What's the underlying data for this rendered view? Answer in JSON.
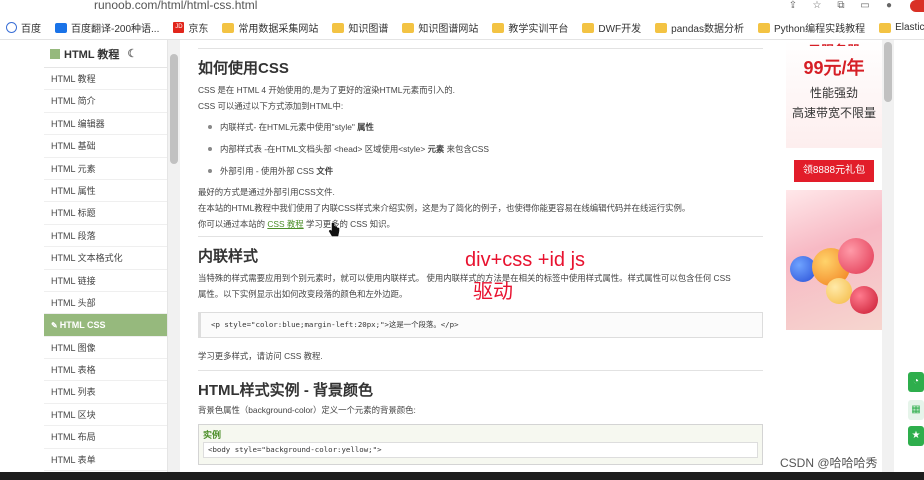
{
  "browser": {
    "url": "runoob.com/html/html-css.html",
    "bookmarks": [
      {
        "label": "百度",
        "icon": "baidu-icon"
      },
      {
        "label": "百度翻译-200种语...",
        "icon": "translate-icon"
      },
      {
        "label": "京东",
        "icon": "jd-icon"
      },
      {
        "label": "常用数据采集网站",
        "icon": "folder-icon"
      },
      {
        "label": "知识图谱",
        "icon": "folder-icon"
      },
      {
        "label": "知识图谱网站",
        "icon": "folder-icon"
      },
      {
        "label": "教学实训平台",
        "icon": "folder-icon"
      },
      {
        "label": "DWF开发",
        "icon": "folder-icon"
      },
      {
        "label": "pandas数据分析",
        "icon": "folder-icon"
      },
      {
        "label": "Python编程实践教程",
        "icon": "folder-icon"
      },
      {
        "label": "Elasticsearch",
        "icon": "folder-icon"
      }
    ],
    "jd_badge": "JD"
  },
  "sidebar": {
    "title": "HTML 教程",
    "moon_icon": "☾",
    "active_tag": "✎",
    "items": [
      {
        "label": "HTML 教程"
      },
      {
        "label": "HTML 简介"
      },
      {
        "label": "HTML 编辑器"
      },
      {
        "label": "HTML 基础"
      },
      {
        "label": "HTML 元素"
      },
      {
        "label": "HTML 属性"
      },
      {
        "label": "HTML 标题"
      },
      {
        "label": "HTML 段落"
      },
      {
        "label": "HTML 文本格式化"
      },
      {
        "label": "HTML 链接"
      },
      {
        "label": "HTML 头部"
      },
      {
        "label": "HTML CSS",
        "active": true
      },
      {
        "label": "HTML 图像"
      },
      {
        "label": "HTML 表格"
      },
      {
        "label": "HTML 列表"
      },
      {
        "label": "HTML 区块"
      },
      {
        "label": "HTML 布局"
      },
      {
        "label": "HTML 表单"
      }
    ]
  },
  "main": {
    "section1": {
      "title": "如何使用CSS",
      "p1": "CSS 是在 HTML 4 开始使用的,是为了更好的渲染HTML元素而引入的.",
      "p2": "CSS 可以通过以下方式添加到HTML中:",
      "bullets": [
        {
          "pre": "内联样式- 在HTML元素中使用\"style\" ",
          "bold": "属性",
          "post": ""
        },
        {
          "pre": "内部样式表 -在HTML文档头部 <head> 区域使用<style> ",
          "bold": "元素",
          "post": " 来包含CSS"
        },
        {
          "pre": "外部引用 - 使用外部 CSS ",
          "bold": "文件",
          "post": ""
        }
      ],
      "p3": "最好的方式是通过外部引用CSS文件.",
      "p4": "在本站的HTML教程中我们使用了内联CSS样式来介绍实例，这是为了简化的例子，也使得你能更容易在线编辑代码并在线运行实例。",
      "p5_pre": "你可以通过本站的 ",
      "p5_link": "CSS 教程",
      "p5_post": " 学习更多的 CSS 知识。"
    },
    "section2": {
      "title": "内联样式",
      "p1": "当特殊的样式需要应用到个别元素时，就可以使用内联样式。 使用内联样式的方法是在相关的标签中使用样式属性。样式属性可以包含任何 CSS",
      "p2": "属性。以下实例显示出如何改变段落的颜色和左外边距。",
      "code": "<p style=\"color:blue;margin-left:20px;\">这是一个段落。</p>",
      "p3": "学习更多样式，请访问 CSS 教程."
    },
    "section3": {
      "title": "HTML样式实例 - 背景颜色",
      "p1": "背景色属性（background-color）定义一个元素的背景颜色:",
      "example_label": "实例",
      "code": "<body style=\"background-color:yellow;\">"
    },
    "annotation_line1": "div+css +id js",
    "annotation_line2": "驱动"
  },
  "ad": {
    "top_cut": "云服务器",
    "price": "99元/年",
    "line1": "性能强劲",
    "line2": "高速带宽不限量",
    "button": "领8888元礼包"
  },
  "watermark": "CSDN @哈哈哈秀"
}
